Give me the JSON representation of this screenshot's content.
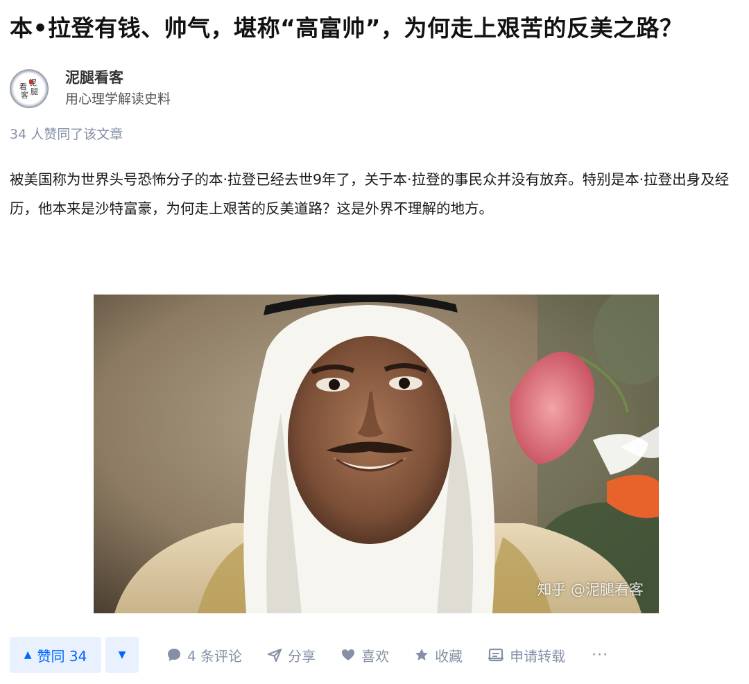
{
  "article": {
    "title": "本•拉登有钱、帅气，堪称“高富帅”，为何走上艰苦的反美之路？",
    "body": "被美国称为世界头号恐怖分子的本·拉登已经去世9年了，关于本·拉登的事民众并没有放弃。特别是本·拉登出身及经历，他本来是沙特富豪，为何走上艰苦的反美道路？这是外界不理解的地方。"
  },
  "author": {
    "name": "泥腿看客",
    "bio": "用心理学解读史料",
    "avatar_seal": [
      "泥",
      "腿",
      "看",
      "客"
    ]
  },
  "likes_line": "34 人赞同了该文章",
  "image": {
    "watermark": "知乎 @泥腿看客"
  },
  "actions": {
    "upvote": "赞同 34",
    "comments": "4 条评论",
    "share": "分享",
    "like": "喜欢",
    "favorite": "收藏",
    "repost": "申请转载",
    "more": "···"
  },
  "colors": {
    "accent": "#0066ff",
    "accent_bg": "#e9f1ff",
    "muted": "#8590a6"
  }
}
